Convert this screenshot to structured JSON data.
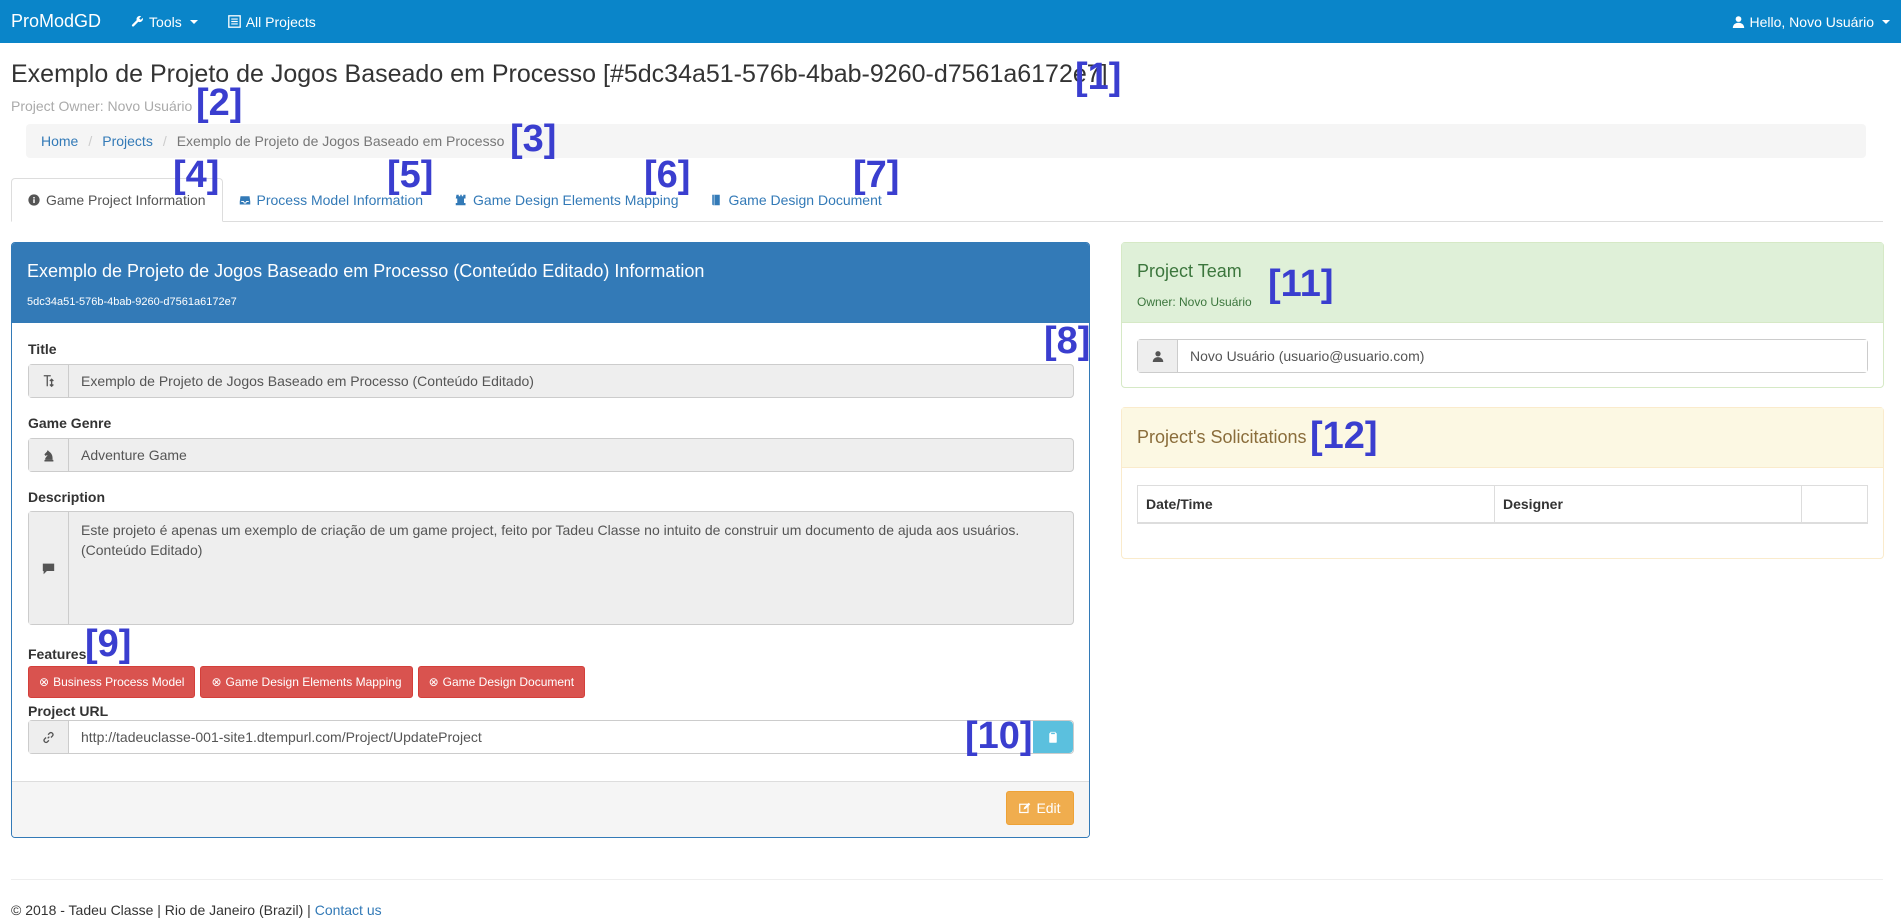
{
  "navbar": {
    "brand": "ProModGD",
    "tools_label": "Tools",
    "all_projects_label": "All Projects",
    "user_label": "Hello, Novo Usuário"
  },
  "header": {
    "title": "Exemplo de Projeto de Jogos Baseado em Processo [#5dc34a51-576b-4bab-9260-d7561a6172e7]",
    "owner": "Project Owner: Novo Usuário"
  },
  "breadcrumb": {
    "home": "Home",
    "projects": "Projects",
    "current": "Exemplo de Projeto de Jogos Baseado em Processo"
  },
  "tabs": [
    {
      "label": "Game Project Information"
    },
    {
      "label": "Process Model Information"
    },
    {
      "label": "Game Design Elements Mapping"
    },
    {
      "label": "Game Design Document"
    }
  ],
  "project_panel": {
    "heading": "Exemplo de Projeto de Jogos Baseado em Processo (Conteúdo Editado) Information",
    "id": "5dc34a51-576b-4bab-9260-d7561a6172e7",
    "title_label": "Title",
    "title_value": "Exemplo de Projeto de Jogos Baseado em Processo (Conteúdo Editado)",
    "genre_label": "Game Genre",
    "genre_value": "Adventure Game",
    "description_label": "Description",
    "description_line1": "Este projeto é apenas um exemplo de criação de um game project, feito por Tadeu Classe no intuito de construir um documento de ajuda aos usuários.",
    "description_line2": "(Conteúdo Editado)",
    "features_label": "Features",
    "features": [
      "Business Process Model",
      "Game Design Elements Mapping",
      "Game Design Document"
    ],
    "url_label": "Project URL",
    "url_value": "http://tadeuclasse-001-site1.dtempurl.com/Project/UpdateProject",
    "edit_label": "Edit"
  },
  "team_panel": {
    "title": "Project Team",
    "owner": "Owner: Novo Usuário",
    "member": "Novo Usuário (usuario@usuario.com)"
  },
  "solicitations_panel": {
    "title": "Project's Solicitations",
    "columns": [
      "Date/Time",
      "Designer",
      ""
    ]
  },
  "markers": [
    "[1]",
    "[2]",
    "[3]",
    "[4]",
    "[5]",
    "[6]",
    "[7]",
    "[8]",
    "[9]",
    "[10]",
    "[11]",
    "[12]"
  ],
  "footer": {
    "text": "© 2018 - Tadeu Classe | Rio de Janeiro (Brazil) |",
    "contact": "Contact us"
  },
  "colors": {
    "navbar": "#0a85c9",
    "primary": "#337ab7",
    "danger": "#d9534f",
    "warning": "#f0ad4e",
    "info": "#5bc0de",
    "marker": "#3a3ecf"
  }
}
